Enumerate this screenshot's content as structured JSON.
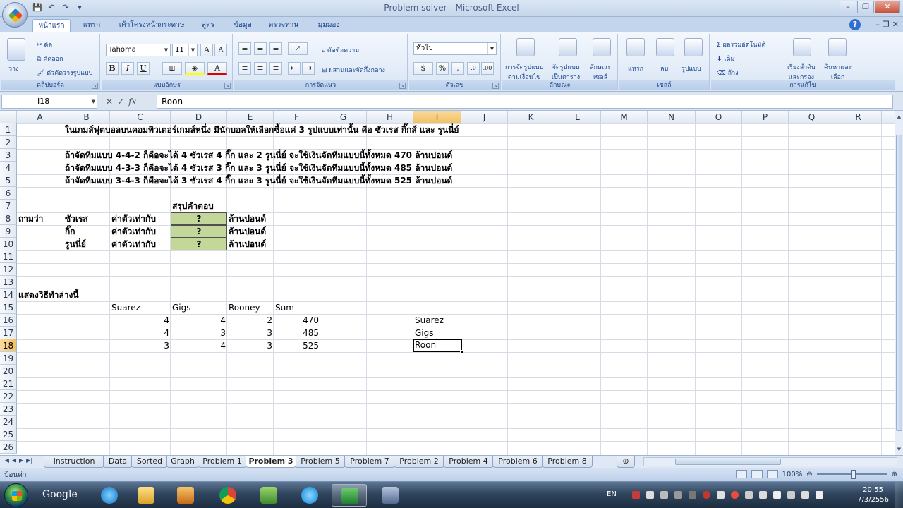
{
  "window": {
    "title": "Problem solver - Microsoft Excel",
    "controls": [
      "–",
      "❐",
      "✕"
    ]
  },
  "ribbon": {
    "tabs": [
      {
        "label": "หน้าแรก",
        "active": true
      },
      {
        "label": "แทรก"
      },
      {
        "label": "เค้าโครงหน้ากระดาษ"
      },
      {
        "label": "สูตร"
      },
      {
        "label": "ข้อมูล"
      },
      {
        "label": "ตรวจทาน"
      },
      {
        "label": "มุมมอง"
      }
    ],
    "groups": {
      "clipboard": {
        "label": "คลิปบอร์ด",
        "paste": "วาง",
        "cut": "ตัด",
        "copy": "คัดลอก",
        "format_painter": "ตัวคัดวางรูปแบบ"
      },
      "font": {
        "label": "แบบอักษร",
        "font_name": "Tahoma",
        "font_size": "11",
        "bold": "B",
        "italic": "I",
        "underline": "U"
      },
      "alignment": {
        "label": "การจัดแนว",
        "wrap": "ตัดข้อความ",
        "merge": "ผสานและจัดกึ่งกลาง"
      },
      "number": {
        "label": "ตัวเลข",
        "format": "ทั่วไป",
        "percent": "%"
      },
      "styles": {
        "label": "ลักษณะ",
        "cond_line1": "การจัดรูปแบบ",
        "cond_line2": "ตามเงื่อนไข",
        "table_line1": "จัดรูปแบบ",
        "table_line2": "เป็นตาราง",
        "cell_line1": "ลักษณะ",
        "cell_line2": "เซลล์"
      },
      "cells": {
        "label": "เซลล์",
        "insert": "แทรก",
        "delete": "ลบ",
        "format": "รูปแบบ"
      },
      "editing": {
        "label": "การแก้ไข",
        "autosum": "ผลรวมอัตโนมัติ",
        "fill": "เติม",
        "clear": "ล้าง",
        "sort_line1": "เรียงลำดับ",
        "sort_line2": "และกรอง",
        "find_line1": "ค้นหาและ",
        "find_line2": "เลือก"
      }
    }
  },
  "formula_bar": {
    "name_box": "I18",
    "fx": "fx",
    "content": "Roon"
  },
  "columns": [
    "A",
    "B",
    "C",
    "D",
    "E",
    "F",
    "G",
    "H",
    "I",
    "J",
    "K",
    "L",
    "M",
    "N",
    "O",
    "P",
    "Q",
    "R"
  ],
  "selected_column": "I",
  "selected_row": "18",
  "rows": [
    "1",
    "2",
    "3",
    "4",
    "5",
    "6",
    "7",
    "8",
    "9",
    "10",
    "11",
    "12",
    "13",
    "14",
    "15",
    "16",
    "17",
    "18",
    "19",
    "20",
    "21",
    "22",
    "23",
    "24",
    "25",
    "26"
  ],
  "cells": {
    "B1": "ในเกมส์ฟุตบอลบนคอมพิวเตอร์เกมส์หนึ่ง  มีนักบอลให้เลือกซื้อแค่ 3 รูปแบบเท่านั้น คือ ซัวเรส กิ๊กส์ และ รูนนี่ย์",
    "B3": "ถ้าจัดทีมแบบ 4-4-2  ก็คือจะได้ 4  ซัวเรส 4 กิ๊ก และ 2 รูนนี่ย์  จะใช้เงินจัดทีมแบบนี้ทั้งหมด 470 ล้านปอนด์",
    "B4": "ถ้าจัดทีมแบบ 4-3-3  ก็คือจะได้ 4  ซัวเรส 3 กิ๊ก และ 3 รูนนี่ย์  จะใช้เงินจัดทีมแบบนี้ทั้งหมด 485 ล้านปอนด์",
    "B5": "ถ้าจัดทีมแบบ 3-4-3  ก็คือจะได้ 3  ซัวเรส 4 กิ๊ก และ 3 รูนนี่ย์  จะใช้เงินจัดทีมแบบนี้ทั้งหมด  525 ล้านปอนด์",
    "D7": "สรุปคำตอบ",
    "A8": "ถามว่า",
    "B8": "ซัวเรส",
    "C8": "ค่าตัวเท่ากับ",
    "D8": "?",
    "E8": "ล้านปอนด์",
    "B9": "กิ๊ก",
    "C9": "ค่าตัวเท่ากับ",
    "D9": "?",
    "E9": "ล้านปอนด์",
    "B10": "รูนนี่ย์",
    "C10": "ค่าตัวเท่ากับ",
    "D10": "?",
    "E10": "ล้านปอนด์",
    "A14": "แสดงวิธีทำล่างนี้",
    "C15": "Suarez",
    "D15": "Gigs",
    "E15": "Rooney",
    "F15": "Sum",
    "C16": "4",
    "D16": "4",
    "E16": "2",
    "F16": "470",
    "C17": "4",
    "D17": "3",
    "E17": "3",
    "F17": "485",
    "C18": "3",
    "D18": "4",
    "E18": "3",
    "F18": "525",
    "I16": "Suarez",
    "I17": "Gigs",
    "I18": "Roon"
  },
  "sheet_tabs": [
    {
      "label": "Instruction"
    },
    {
      "label": "Data"
    },
    {
      "label": "Sorted"
    },
    {
      "label": "Graph"
    },
    {
      "label": "Problem 1"
    },
    {
      "label": "Problem 3",
      "active": true
    },
    {
      "label": "Problem 5"
    },
    {
      "label": "Problem 7"
    },
    {
      "label": "Problem 2"
    },
    {
      "label": "Problem 4"
    },
    {
      "label": "Problem 6"
    },
    {
      "label": "Problem 8"
    }
  ],
  "status": {
    "mode": "ป้อนค่า",
    "zoom": "100%"
  },
  "taskbar": {
    "google": "Google",
    "lang": "EN",
    "time": "20:55",
    "date": "7/3/2556"
  }
}
